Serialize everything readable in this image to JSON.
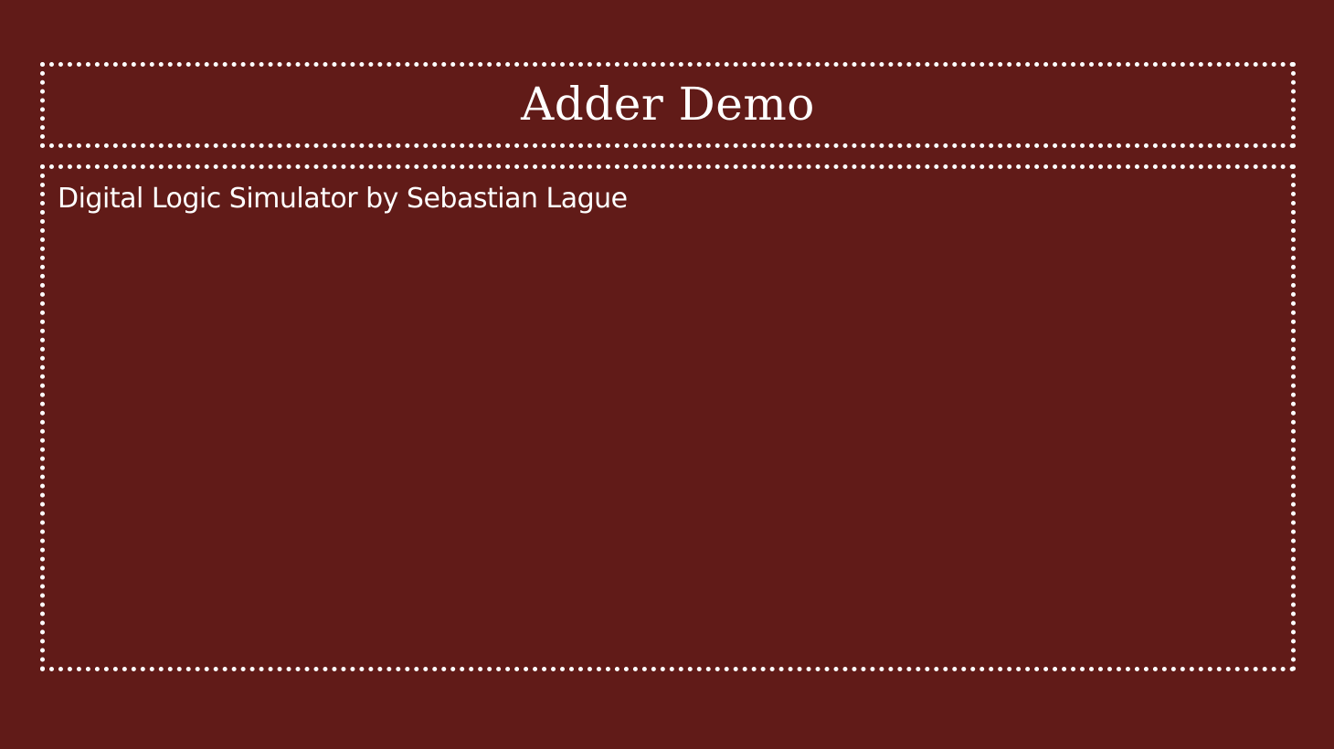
{
  "slide": {
    "title": "Adder Demo",
    "subtitle": "Digital Logic Simulator by Sebastian Lague"
  },
  "colors": {
    "background": "#611b18",
    "border": "#ffffff",
    "text": "#ffffff"
  }
}
